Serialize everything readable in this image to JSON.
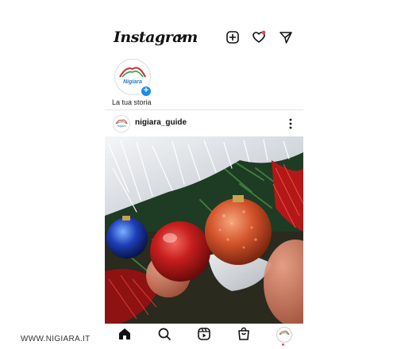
{
  "app": {
    "brand": "Instagram"
  },
  "stories": [
    {
      "label": "La tua storia",
      "avatar_text": "Nigiara"
    }
  ],
  "post": {
    "username": "nigiara_guide",
    "avatar_text": "Nigiara",
    "image": "christmas-ornaments-photo"
  },
  "header_icons": [
    "add-post-icon",
    "heart-icon",
    "direct-message-icon"
  ],
  "nav": [
    "home-icon",
    "search-icon",
    "reels-icon",
    "shop-icon",
    "profile-icon"
  ],
  "watermark": "WWW.NIGIARA.IT",
  "colors": {
    "accent_blue": "#1a8cf0",
    "notification_red": "#ed4956",
    "logo_green": "#2e9a4a",
    "logo_red": "#d22b2b"
  }
}
